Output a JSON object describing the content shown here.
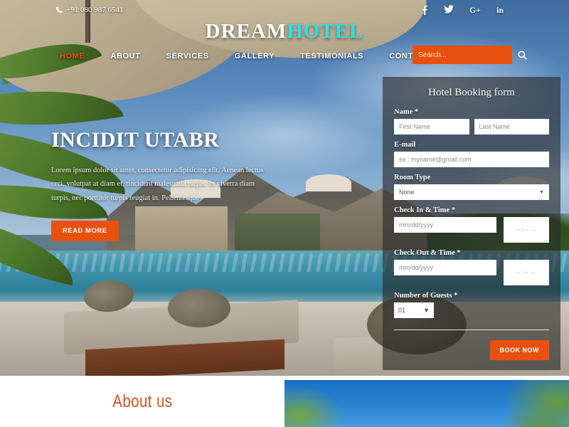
{
  "topbar": {
    "phone": "+91 080 987 6541",
    "phone_icon": "phone-icon",
    "socials": [
      {
        "name": "facebook",
        "label": "f"
      },
      {
        "name": "twitter",
        "label": "t"
      },
      {
        "name": "google-plus",
        "label": "G+"
      },
      {
        "name": "linkedin",
        "label": "in"
      }
    ]
  },
  "logo": {
    "part1": "DREAM",
    "part2": "HOTEL"
  },
  "nav": {
    "items": [
      {
        "label": "HOME",
        "active": true
      },
      {
        "label": "ABOUT",
        "active": false
      },
      {
        "label": "SERVICES",
        "active": false
      },
      {
        "label": "GALLERY",
        "active": false
      },
      {
        "label": "TESTIMONIALS",
        "active": false
      },
      {
        "label": "CONTACT US",
        "active": false
      }
    ]
  },
  "search": {
    "placeholder": "Search...",
    "value": "",
    "icon": "search-icon"
  },
  "hero": {
    "title": "INCIDIT UTABR",
    "text": "Lorem ipsum dolor sit amet, consectetur adipisicing elit. Aenean lectus orci, volutpat at diam et, tincidunt malesuada turpis. In viverra diam turpis, nec porttitor turpis feugiat in. Pellentesque",
    "button": "READ MORE"
  },
  "booking": {
    "title": "Hotel Booking form",
    "name_label": "Name *",
    "first_name_placeholder": "First Name",
    "last_name_placeholder": "Last Name",
    "email_label": "E-mail",
    "email_placeholder": "ex : myname@gmail.com",
    "room_type_label": "Room Type",
    "room_type_value": "None",
    "checkin_label": "Check In & Time *",
    "checkin_date_placeholder": "mm/dd/yyyy",
    "checkin_time_value": "--:-- --",
    "checkout_label": "Check Out & Time *",
    "checkout_date_placeholder": "mm/dd/yyyy",
    "checkout_time_value": "--:-- --",
    "guests_label": "Number of Guests *",
    "guests_value": "01",
    "submit": "BOOK NOW"
  },
  "about": {
    "title": "About us"
  },
  "colors": {
    "accent_orange": "#e8500e",
    "logo_cyan": "#2ee0e8",
    "about_title": "#d4541f",
    "form_overlay": "rgba(40,40,40,.62)"
  }
}
